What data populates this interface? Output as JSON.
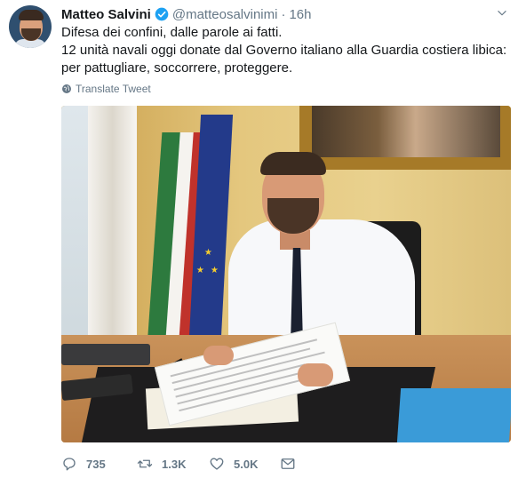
{
  "tweet": {
    "display_name": "Matteo Salvini",
    "handle": "@matteosalvinimi",
    "separator": "·",
    "time": "16h",
    "body_lines": [
      "Difesa dei confini, dalle parole ai fatti.",
      "12 unità navali oggi donate dal Governo italiano alla Guardia costiera libica: per pattugliare, soccorrere, proteggere."
    ],
    "translate_label": "Translate Tweet",
    "icons": {
      "verified": "verified-badge-icon",
      "more": "chevron-down-icon",
      "translate": "globe-icon",
      "reply": "reply-icon",
      "retweet": "retweet-icon",
      "like": "heart-icon",
      "dm": "envelope-icon"
    }
  },
  "actions": {
    "reply_count": "735",
    "retweet_count": "1.3K",
    "like_count": "5.0K"
  },
  "colors": {
    "text": "#14171a",
    "secondary": "#657786",
    "verified": "#1da1f2"
  }
}
